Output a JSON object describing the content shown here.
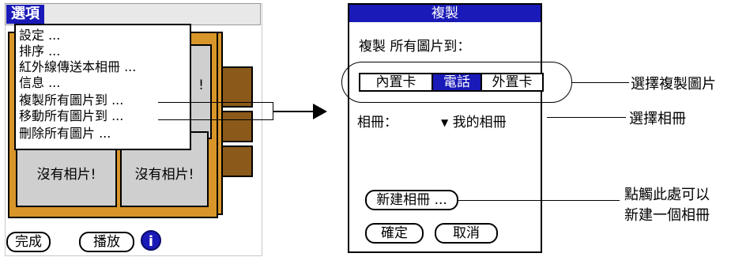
{
  "left": {
    "menubar_title": "選項",
    "menu_items": [
      "設定 ...",
      "排序 ...",
      "紅外線傳送本相冊 ...",
      "信息 ...",
      "複製所有圖片到 ...",
      "移動所有圖片到 ...",
      "刪除所有圖片 ..."
    ],
    "thumb_bang": "!",
    "thumb_empty_1": "沒有相片!",
    "thumb_empty_2": "沒有相片!",
    "done_label": "完成",
    "play_label": "播放",
    "info_glyph": "i"
  },
  "dialog": {
    "title": "複製",
    "prompt": "複製 所有圖片到：",
    "targets": [
      "內置卡",
      "電話",
      "外置卡"
    ],
    "selected_target": "電話",
    "album_label": "相冊：",
    "album_value": "我的相冊",
    "new_album_label": "新建相冊 ...",
    "ok_label": "確定",
    "cancel_label": "取消"
  },
  "callouts": {
    "select_copy": "選擇複製圖片",
    "select_album": "選擇相冊",
    "new_album_line1": "點觸此處可以",
    "new_album_line2": "新建一個相冊"
  },
  "colors": {
    "highlight": "#1a1ab8",
    "album_frame": "#d8962a",
    "album_tab": "#8b5a1a"
  }
}
